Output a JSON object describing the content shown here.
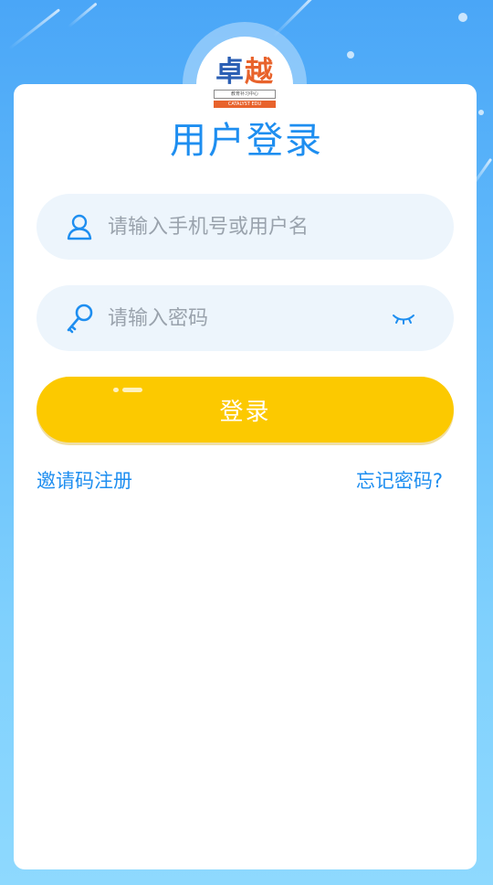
{
  "logo": {
    "name_main": "卓",
    "name_accent": "越",
    "subtitle_cn": "教育补习中心",
    "subtitle_en": "CATALYST EDU"
  },
  "page": {
    "title": "用户登录"
  },
  "form": {
    "username": {
      "placeholder": "请输入手机号或用户名",
      "value": "",
      "icon": "user-icon"
    },
    "password": {
      "placeholder": "请输入密码",
      "value": "",
      "icon": "key-icon",
      "toggle_icon": "eye-closed-icon"
    },
    "login_label": "登录"
  },
  "links": {
    "register": "邀请码注册",
    "forgot": "忘记密码?"
  },
  "colors": {
    "accent": "#1e8ef0",
    "button": "#fcc900",
    "field_bg": "#edf5fc"
  }
}
